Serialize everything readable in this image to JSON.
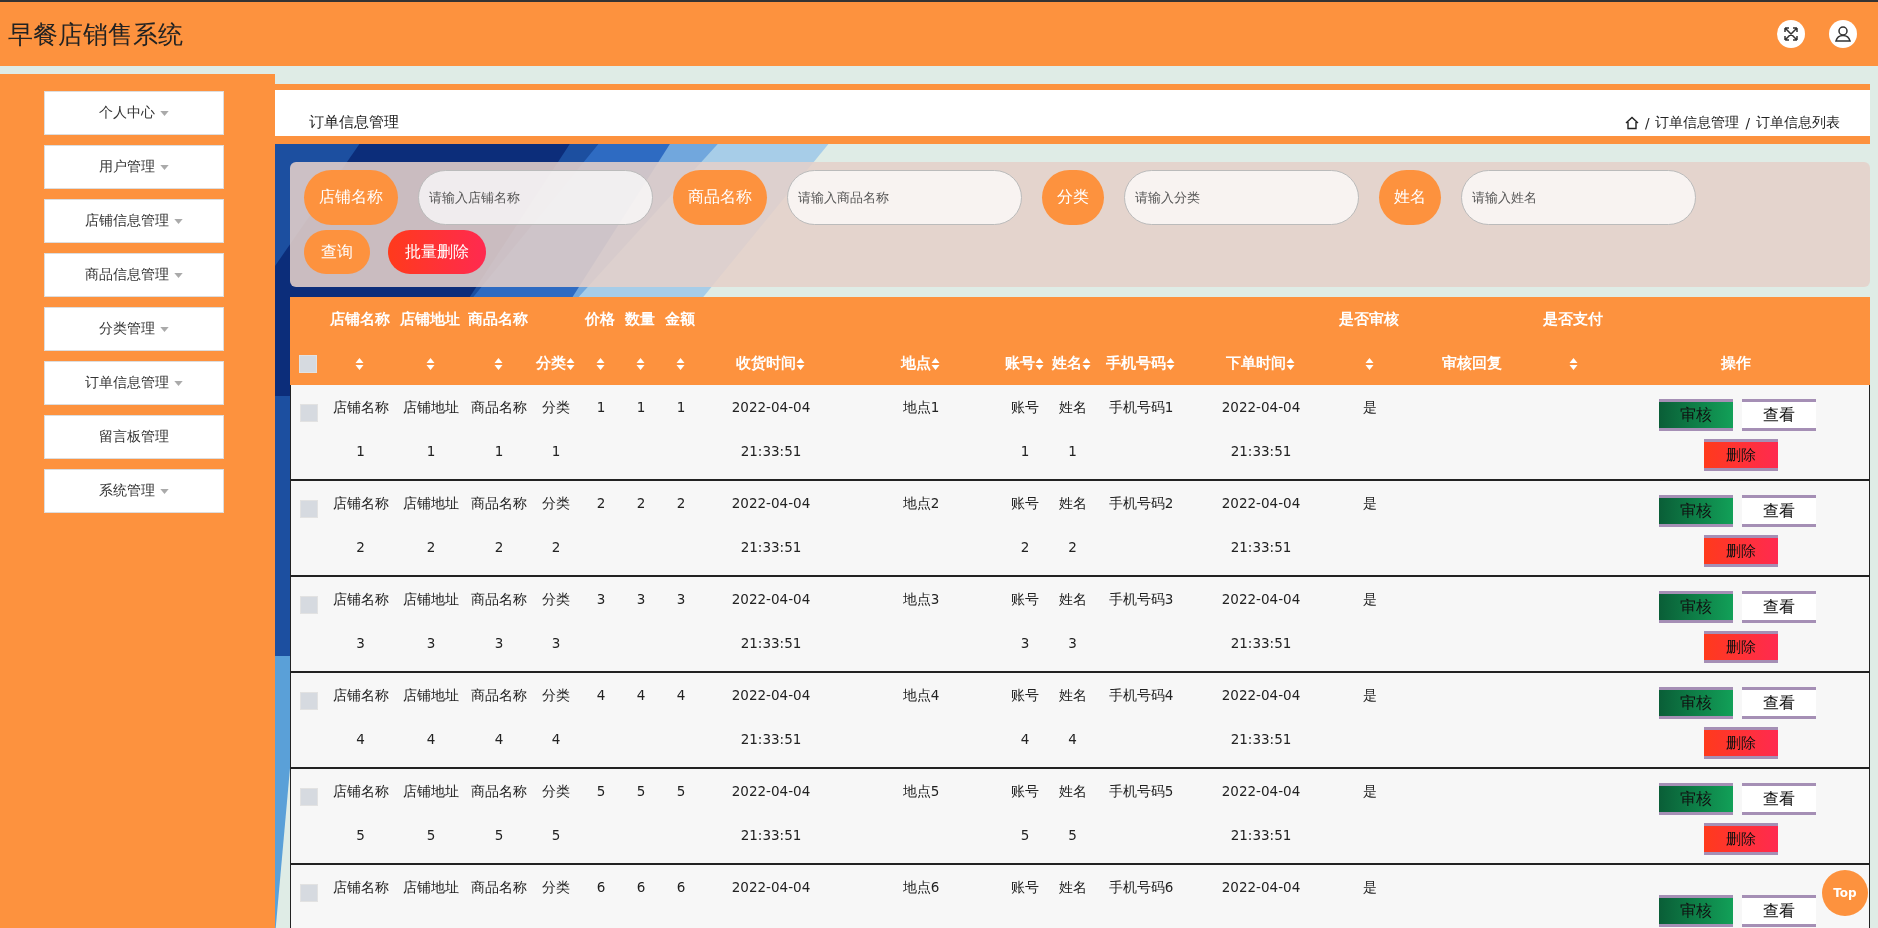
{
  "header": {
    "title": "早餐店销售系统"
  },
  "sidebar": {
    "items": [
      {
        "label": "个人中心",
        "has_submenu": true
      },
      {
        "label": "用户管理",
        "has_submenu": true
      },
      {
        "label": "店铺信息管理",
        "has_submenu": true
      },
      {
        "label": "商品信息管理",
        "has_submenu": true
      },
      {
        "label": "分类管理",
        "has_submenu": true
      },
      {
        "label": "订单信息管理",
        "has_submenu": true
      },
      {
        "label": "留言板管理",
        "has_submenu": false
      },
      {
        "label": "系统管理",
        "has_submenu": true
      }
    ]
  },
  "page_title": "订单信息管理",
  "breadcrumb": {
    "separator": "/",
    "items": [
      "订单信息管理",
      "订单信息列表"
    ]
  },
  "search": {
    "fields": [
      {
        "label": "店铺名称",
        "placeholder": "请输入店铺名称"
      },
      {
        "label": "商品名称",
        "placeholder": "请输入商品名称"
      },
      {
        "label": "分类",
        "placeholder": "请输入分类"
      },
      {
        "label": "姓名",
        "placeholder": "请输入姓名"
      }
    ],
    "buttons": [
      {
        "label": "查询",
        "kind": "query"
      },
      {
        "label": "批量删除",
        "kind": "danger"
      }
    ]
  },
  "table": {
    "select_all_checked": false,
    "columns": [
      {
        "label": "店铺名称",
        "sortable": true
      },
      {
        "label": "店铺地址",
        "sortable": true
      },
      {
        "label": "商品名称",
        "sortable": true
      },
      {
        "label": "分类",
        "sortable": true
      },
      {
        "label": "价格",
        "sortable": true
      },
      {
        "label": "数量",
        "sortable": true
      },
      {
        "label": "金额",
        "sortable": true
      },
      {
        "label": "收货时间",
        "sortable": true
      },
      {
        "label": "地点",
        "sortable": true
      },
      {
        "label": "账号",
        "sortable": true
      },
      {
        "label": "姓名",
        "sortable": true
      },
      {
        "label": "手机号码",
        "sortable": true
      },
      {
        "label": "下单时间",
        "sortable": true
      },
      {
        "label": "是否审核",
        "sortable": true
      },
      {
        "label": "审核回复",
        "sortable": false
      },
      {
        "label": "是否支付",
        "sortable": true
      },
      {
        "label": "操作",
        "sortable": false
      }
    ],
    "rows": [
      {
        "checked": false,
        "cells": [
          "店铺名称\n1",
          "店铺地址\n1",
          "商品名称\n1",
          "分类\n1",
          "1",
          "1",
          "1",
          "2022-04-04\n21:33:51",
          "地点1",
          "账号\n1",
          "姓名\n1",
          "手机号码1",
          "2022-04-04\n21:33:51",
          "是"
        ],
        "actions": [
          {
            "label": "审核",
            "kind": "audit"
          },
          {
            "label": "查看",
            "kind": "view"
          },
          {
            "label": "删除",
            "kind": "delete"
          }
        ]
      },
      {
        "checked": false,
        "cells": [
          "店铺名称\n2",
          "店铺地址\n2",
          "商品名称\n2",
          "分类\n2",
          "2",
          "2",
          "2",
          "2022-04-04\n21:33:51",
          "地点2",
          "账号\n2",
          "姓名\n2",
          "手机号码2",
          "2022-04-04\n21:33:51",
          "是"
        ],
        "actions": [
          {
            "label": "审核",
            "kind": "audit"
          },
          {
            "label": "查看",
            "kind": "view"
          },
          {
            "label": "删除",
            "kind": "delete"
          }
        ]
      },
      {
        "checked": false,
        "cells": [
          "店铺名称\n3",
          "店铺地址\n3",
          "商品名称\n3",
          "分类\n3",
          "3",
          "3",
          "3",
          "2022-04-04\n21:33:51",
          "地点3",
          "账号\n3",
          "姓名\n3",
          "手机号码3",
          "2022-04-04\n21:33:51",
          "是"
        ],
        "actions": [
          {
            "label": "审核",
            "kind": "audit"
          },
          {
            "label": "查看",
            "kind": "view"
          },
          {
            "label": "删除",
            "kind": "delete"
          }
        ]
      },
      {
        "checked": false,
        "cells": [
          "店铺名称\n4",
          "店铺地址\n4",
          "商品名称\n4",
          "分类\n4",
          "4",
          "4",
          "4",
          "2022-04-04\n21:33:51",
          "地点4",
          "账号\n4",
          "姓名\n4",
          "手机号码4",
          "2022-04-04\n21:33:51",
          "是"
        ],
        "actions": [
          {
            "label": "审核",
            "kind": "audit"
          },
          {
            "label": "查看",
            "kind": "view"
          },
          {
            "label": "删除",
            "kind": "delete"
          }
        ]
      },
      {
        "checked": false,
        "cells": [
          "店铺名称\n5",
          "店铺地址\n5",
          "商品名称\n5",
          "分类\n5",
          "5",
          "5",
          "5",
          "2022-04-04\n21:33:51",
          "地点5",
          "账号\n5",
          "姓名\n5",
          "手机号码5",
          "2022-04-04\n21:33:51",
          "是"
        ],
        "actions": [
          {
            "label": "审核",
            "kind": "audit"
          },
          {
            "label": "查看",
            "kind": "view"
          },
          {
            "label": "删除",
            "kind": "delete"
          }
        ]
      },
      {
        "checked": false,
        "cells": [
          "店铺名称",
          "店铺地址",
          "商品名称",
          "分类",
          "6",
          "6",
          "6",
          "2022-04-04",
          "地点6",
          "账号",
          "姓名",
          "手机号码6",
          "2022-04-04",
          "是"
        ],
        "actions": [
          {
            "label": "审核",
            "kind": "audit"
          },
          {
            "label": "查看",
            "kind": "view"
          }
        ]
      }
    ]
  },
  "back_to_top": {
    "label": "Top"
  }
}
